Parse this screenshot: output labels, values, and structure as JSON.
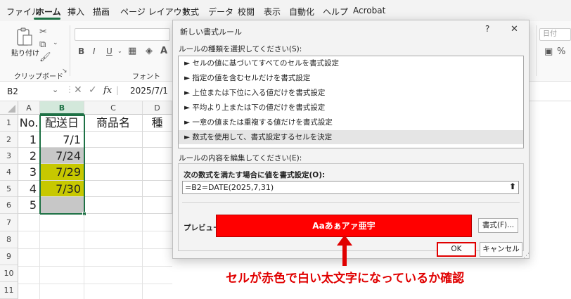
{
  "menu": {
    "tabs": [
      "ファイル",
      "ホーム",
      "挿入",
      "描画",
      "ページ レイアウト",
      "数式",
      "データ",
      "校閲",
      "表示",
      "自動化",
      "ヘルプ",
      "Acrobat"
    ],
    "active": "ホーム"
  },
  "ribbon": {
    "paste_label": "貼り付け",
    "clipboard_label": "クリップボード",
    "font_label": "フォント",
    "number_format": "日付"
  },
  "formula_bar": {
    "name_box": "B2",
    "fx": "fx",
    "value": "2025/7/1"
  },
  "sheet": {
    "columns": [
      "A",
      "B",
      "C",
      "D"
    ],
    "rows": [
      "1",
      "2",
      "3",
      "4",
      "5",
      "6",
      "7",
      "8",
      "9",
      "10",
      "11"
    ],
    "header_row": [
      "No.",
      "配送日",
      "商品名",
      "種"
    ],
    "data": [
      {
        "no": "1",
        "date": "7/1"
      },
      {
        "no": "2",
        "date": "7/24"
      },
      {
        "no": "3",
        "date": "7/29"
      },
      {
        "no": "4",
        "date": "7/30"
      },
      {
        "no": "5",
        "date": ""
      }
    ],
    "colors": {
      "gray": "#c7c7c7",
      "yellow": "#c7c800",
      "accent": "#1e7145"
    }
  },
  "dialog": {
    "title": "新しい書式ルール",
    "help": "?",
    "close": "✕",
    "select_type_label": "ルールの種類を選択してください(S):",
    "rule_types": [
      "► セルの値に基づいてすべてのセルを書式設定",
      "► 指定の値を含むセルだけを書式設定",
      "► 上位または下位に入る値だけを書式設定",
      "► 平均より上または下の値だけを書式設定",
      "► 一意の値または重複する値だけを書式設定",
      "► 数式を使用して、書式設定するセルを決定"
    ],
    "edit_label": "ルールの内容を編集してください(E):",
    "formula_label": "次の数式を満たす場合に値を書式設定(O):",
    "formula_value": "=B2=DATE(2025,7,31)",
    "preview_label": "プレビュー:",
    "preview_text": "Aaあぁアァ亜宇",
    "format_button": "書式(F)...",
    "ok_button": "OK",
    "cancel_button": "キャンセル",
    "preview_color": "#ff0000"
  },
  "annotation": {
    "text": "セルが赤色で白い太文字になっているか確認",
    "color": "#e00000"
  }
}
